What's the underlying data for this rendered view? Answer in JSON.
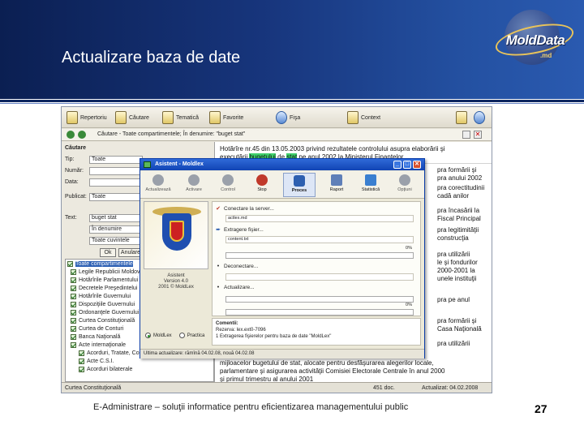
{
  "slide": {
    "title": "Actualizare baza de date",
    "logo_text": "MoldData",
    "logo_suffix": ".md",
    "footer": "E-Administrare – soluţii informatice pentru eficientizarea managementului public",
    "page_number": "27"
  },
  "app": {
    "toolbar": [
      "Repertoriu",
      "Căutare",
      "Tematică",
      "Favorite",
      "Fişa",
      "Context"
    ],
    "search_bar": "Căutare - Toate compartimentele; În denumire: \"buget stat\"",
    "filter": {
      "header": "Căutare",
      "tip_label": "Tip:",
      "tip_value": "Toate",
      "numar_label": "Număr:",
      "numar_value": "",
      "data_label": "Data:",
      "data_value": "",
      "publicat_label": "Publicat:",
      "publicat_value": "Toate",
      "text_label": "Text:",
      "text_value": "buget stat",
      "mode1": "În denumire",
      "mode2": "Toate cuvintele",
      "ok": "Ok",
      "cancel": "Anulare"
    },
    "tree": [
      "Toate compartimentele",
      "Legile Republicii Moldova",
      "Hotărîrile Parlamentului",
      "Decretele Preşedintelui",
      "Hotărîrile Guvernului",
      "Dispoziţiile Guvernului",
      "Ordonanţele Guvernului",
      "Curtea Constituţională",
      "Curtea de Conturi",
      "Banca Naţională",
      "Acte internaţionale",
      "Acorduri, Tratate, Convenţii",
      "Acte C.S.I.",
      "Acorduri bilaterale"
    ],
    "doc_lines": [
      "Hotărîre nr.45 din 13.05.2003 privind rezultatele controlului asupra elaborării şi",
      "executării bugetului de stat pe anul 2002 la Ministerul Finanţelor",
      "pra formării şi",
      "pra anului 2002",
      "pra corectitudinii",
      "cadă anilor",
      "pra încasării la",
      "Fiscal Principal",
      "pra legitimităţii",
      "construcţia",
      "pra utilizării",
      "le şi fondurilor",
      "2000-2001 la",
      "unele instituţii",
      "pra pe anul",
      "pra formării şi",
      "Casa Naţională",
      "pra utilizării",
      "mijloacelor bugetului de stat, alocate pentru desfăşurarea alegerilor locale,",
      "parlamentare şi asigurarea activităţii Comisiei Electorale Centrale în anul 2000",
      "şi primul trimestru al anului 2001"
    ],
    "status_left": "Curtea Constituţională",
    "status_count": "451 doc.",
    "status_updated": "Actualizat: 04.02.2008"
  },
  "dialog": {
    "title": "Asistent - Moldlex",
    "toolbar": [
      "Actualizează",
      "Activare",
      "Control",
      "Stop",
      "Proces",
      "Raport",
      "Statistică",
      "Opţiuni"
    ],
    "brand": "Asistent",
    "version": "Version 4.0",
    "copyright": "2001 © MoldLex",
    "steps": [
      {
        "label": "Conectare la server...",
        "value": "actlex.md"
      },
      {
        "label": "Extragere fişier...",
        "value": "content.txt",
        "progress_label": "0%"
      },
      {
        "label": "Deconectare...",
        "value": ""
      },
      {
        "label": "Actualizare...",
        "progress_label": "0%"
      }
    ],
    "comment_label": "Comentii:",
    "comment_lines": [
      "Rezerva: lex.ext0-7096",
      "1 Extragerea fişierelor pentru baza de date \"MoldLex\""
    ],
    "radio1": "MoldLex",
    "radio2": "Practica",
    "status": "Ultima actualizare: rămînă 04.02.08, nouă 04.02.08"
  }
}
